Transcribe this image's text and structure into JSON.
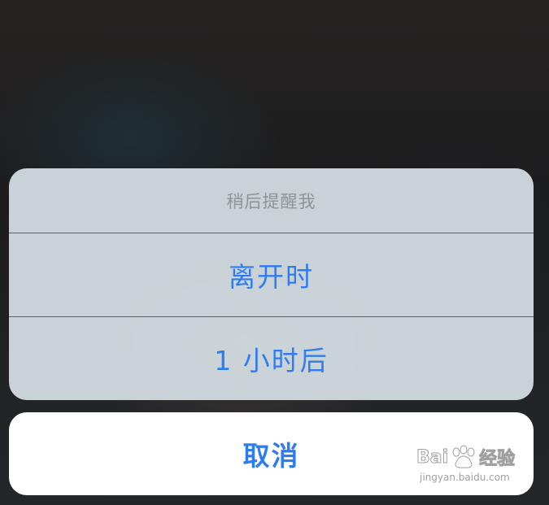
{
  "action_sheet": {
    "title": "稍后提醒我",
    "actions": [
      {
        "label": "离开时"
      },
      {
        "label": "1 小时后"
      }
    ],
    "cancel_label": "取消"
  },
  "watermark": {
    "brand_left": "Bai",
    "brand_right": "经验",
    "url": "jingyan.baidu.com"
  },
  "colors": {
    "accent": "#2f7cf0",
    "sheet_background": "#d6e0e4",
    "title_text": "#8e9497"
  }
}
